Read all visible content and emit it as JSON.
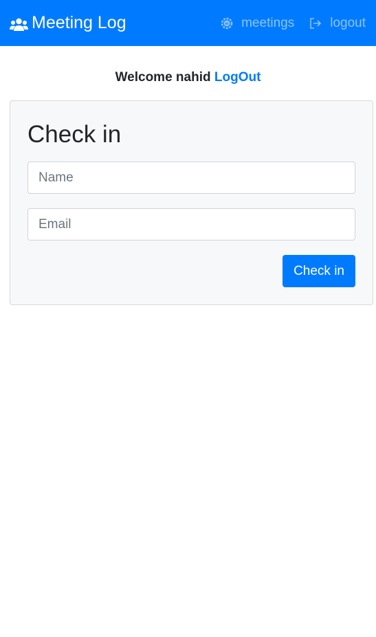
{
  "navbar": {
    "brand_icon": "users-icon",
    "brand_text": "Meeting Log",
    "links": [
      {
        "label": "meetings",
        "icon": "meetings-icon"
      },
      {
        "label": "logout",
        "icon": "sign-out-icon"
      }
    ]
  },
  "welcome": {
    "text": "Welcome nahid",
    "logout_label": "LogOut"
  },
  "checkin_form": {
    "title": "Check in",
    "name_placeholder": "Name",
    "email_placeholder": "Email",
    "submit_label": "Check in"
  },
  "colors": {
    "primary": "#007bff",
    "card_bg": "#f7f8fa"
  }
}
